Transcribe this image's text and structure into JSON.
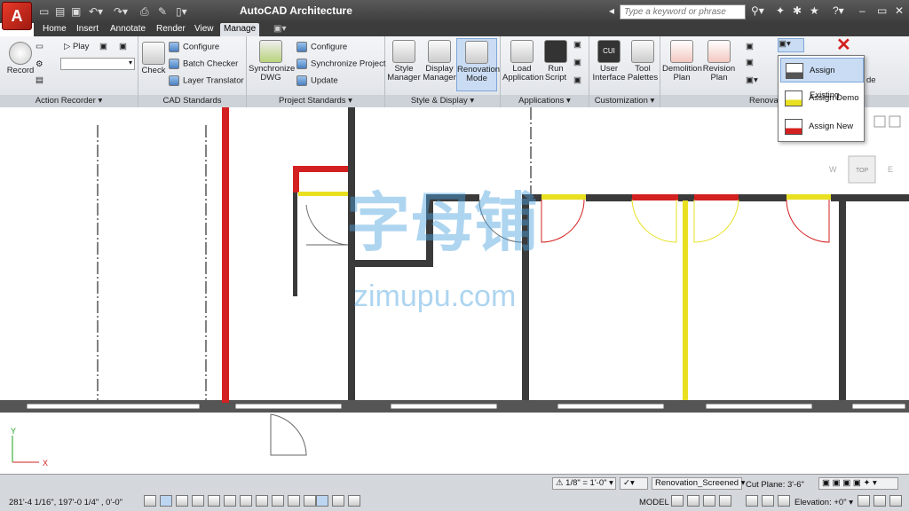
{
  "app": {
    "logo": "A",
    "title": "AutoCAD Architecture"
  },
  "quick_access": {
    "icons": [
      "new-icon",
      "open-icon",
      "save-icon",
      "undo-icon",
      "redo-icon",
      "plot-icon",
      "properties-icon",
      "document-icon"
    ]
  },
  "search": {
    "placeholder": "Type a keyword or phrase"
  },
  "tabs": [
    {
      "label": "Home"
    },
    {
      "label": "Insert"
    },
    {
      "label": "Annotate"
    },
    {
      "label": "Render"
    },
    {
      "label": "View"
    },
    {
      "label": "Manage"
    }
  ],
  "active_tab": "Manage",
  "ribbon": {
    "action_recorder": {
      "record": "Record",
      "play": "Play",
      "panel": "Action Recorder ▾"
    },
    "cad_standards": {
      "check": "Check",
      "configure": "Configure",
      "batch_checker": "Batch Checker",
      "layer_translator": "Layer Translator",
      "panel": "CAD Standards"
    },
    "project_standards": {
      "sync_dwg": "Synchronize DWG",
      "configure": "Configure",
      "sync_project": "Synchronize Project",
      "update": "Update",
      "panel": "Project Standards ▾"
    },
    "style_display": {
      "style_manager": "Style Manager",
      "display_manager": "Display Manager",
      "renovation_mode": "Renovation Mode",
      "panel": "Style & Display ▾"
    },
    "applications": {
      "load_app": "Load Application",
      "run_script": "Run Script",
      "panel": "Applications ▾"
    },
    "customization": {
      "user_interface": "User Interface",
      "tool_palettes": "Tool Palettes",
      "panel": "Customization ▾"
    },
    "renovation": {
      "demolition_plan": "Demolition Plan",
      "revision_plan": "Revision Plan",
      "panel": "Renovati",
      "mode_suffix": "de"
    }
  },
  "dropdown": {
    "items": [
      {
        "label": "Assign Existing",
        "active": true
      },
      {
        "label": "Assign Demo",
        "active": false
      },
      {
        "label": "Assign New",
        "active": false
      }
    ]
  },
  "viewcube": {
    "w": "W",
    "top": "TOP",
    "e": "E"
  },
  "ucs": {
    "x": "X",
    "y": "Y"
  },
  "watermark": {
    "chars": "字母铺",
    "url": "zimupu.com"
  },
  "status": {
    "coords": "281'-4 1/16\", 197'-0 1/4\" , 0'-0\"",
    "scale": "1/8\" = 1'-0\" ▾",
    "display_config": "Renovation_Screened",
    "cut_plane": "Cut Plane:",
    "cut_plane_value": "3'-6\"",
    "model": "MODEL",
    "elevation": "Elevation:",
    "elevation_value": "+0\""
  },
  "colors": {
    "accent": "#3d6fb8",
    "wall_existing": "#3a3a3a",
    "wall_demo": "#d32020",
    "wall_new": "#e8e020"
  }
}
